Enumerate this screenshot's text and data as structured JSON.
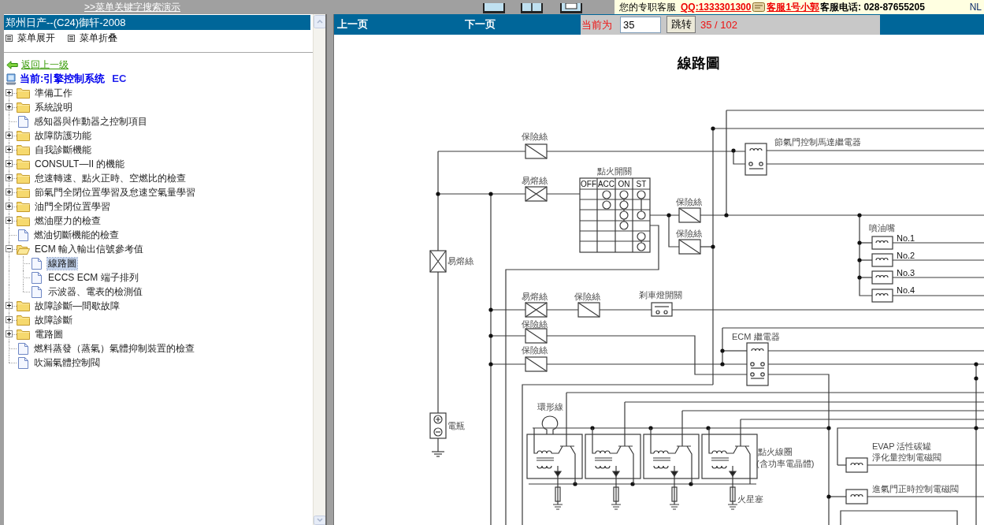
{
  "top_bar": {
    "search_demo_link": ">>菜单关键字搜索演示",
    "service_text": "您的专职客服",
    "qq_link": "QQ:1333301300",
    "agent_link": "客服1号小郭",
    "phone": "客服电话: 028-87655205",
    "corner": "NL"
  },
  "sidebar": {
    "title": "郑州日产--(C24)御轩-2008",
    "actions": [
      "菜单展开",
      "菜单折叠"
    ],
    "back_link": "返回上一级",
    "current": {
      "label": "当前:引擎控制系统",
      "code": "EC"
    },
    "tree": [
      {
        "label": "準備工作",
        "kind": "folder",
        "expanded": false,
        "selected": false
      },
      {
        "label": "系統說明",
        "kind": "folder",
        "expanded": false,
        "selected": false
      },
      {
        "label": "感知器與作動器之控制項目",
        "kind": "page",
        "selected": false
      },
      {
        "label": "故障防護功能",
        "kind": "folder",
        "expanded": false,
        "selected": false
      },
      {
        "label": "自我診斷機能",
        "kind": "folder",
        "expanded": false,
        "selected": false
      },
      {
        "label": "CONSULT—II 的機能",
        "kind": "folder",
        "expanded": false,
        "selected": false
      },
      {
        "label": "怠速轉速、點火正時、空燃比的檢查",
        "kind": "folder",
        "expanded": false,
        "selected": false
      },
      {
        "label": "節氣門全閉位置學習及怠速空氣量學習",
        "kind": "folder",
        "expanded": false,
        "selected": false
      },
      {
        "label": "油門全閉位置學習",
        "kind": "folder",
        "expanded": false,
        "selected": false
      },
      {
        "label": "燃油壓力的檢查",
        "kind": "folder",
        "expanded": false,
        "selected": false
      },
      {
        "label": "燃油切斷機能的檢查",
        "kind": "page",
        "selected": false
      },
      {
        "label": "ECM 輸入輸出信號參考值",
        "kind": "folder",
        "expanded": true,
        "selected": false,
        "children": [
          {
            "label": "線路圖",
            "kind": "page",
            "selected": true
          },
          {
            "label": "ECCS ECM 端子排列",
            "kind": "page",
            "selected": false
          },
          {
            "label": "示波器、電表的檢測值",
            "kind": "page",
            "selected": false
          }
        ]
      },
      {
        "label": "故障診斷—間歇故障",
        "kind": "folder",
        "expanded": false,
        "selected": false
      },
      {
        "label": "故障診斷",
        "kind": "folder",
        "expanded": false,
        "selected": false
      },
      {
        "label": "電路圖",
        "kind": "folder",
        "expanded": false,
        "selected": false
      },
      {
        "label": "燃料蒸發（蒸氣）氣體抑制裝置的檢查",
        "kind": "page",
        "selected": false
      },
      {
        "label": "吹漏氣體控制閥",
        "kind": "page",
        "selected": false
      }
    ]
  },
  "viewer": {
    "prev": "上一页",
    "next": "下一页",
    "current_label": "当前为",
    "page_input": "35",
    "go_button": "跳转",
    "page_count": "35 / 102",
    "document": {
      "title": "線路圖",
      "diagram": {
        "labels": [
          "保險絲",
          "節氣門控制馬達繼電器",
          "易熔絲",
          "保險絲",
          "保險絲",
          "易熔絲",
          "易熔絲",
          "保險絲",
          "剎車燈開關",
          "保險絲",
          "保險絲",
          "ECM 繼電器",
          "環形線",
          "電瓶",
          "點火線圈",
          "(含功率電晶體)",
          "EVAP 活性碳罐",
          "淨化量控制電磁閥",
          "進氣門正時控制電磁閥",
          "火星塞"
        ],
        "ignition_switch": {
          "label": "點火開關",
          "positions": [
            "OFF",
            "ACC",
            "ON",
            "ST"
          ]
        },
        "injectors": {
          "label": "噴油嘴",
          "items": [
            "No.1",
            "No.2",
            "No.3",
            "No.4"
          ]
        }
      }
    }
  }
}
